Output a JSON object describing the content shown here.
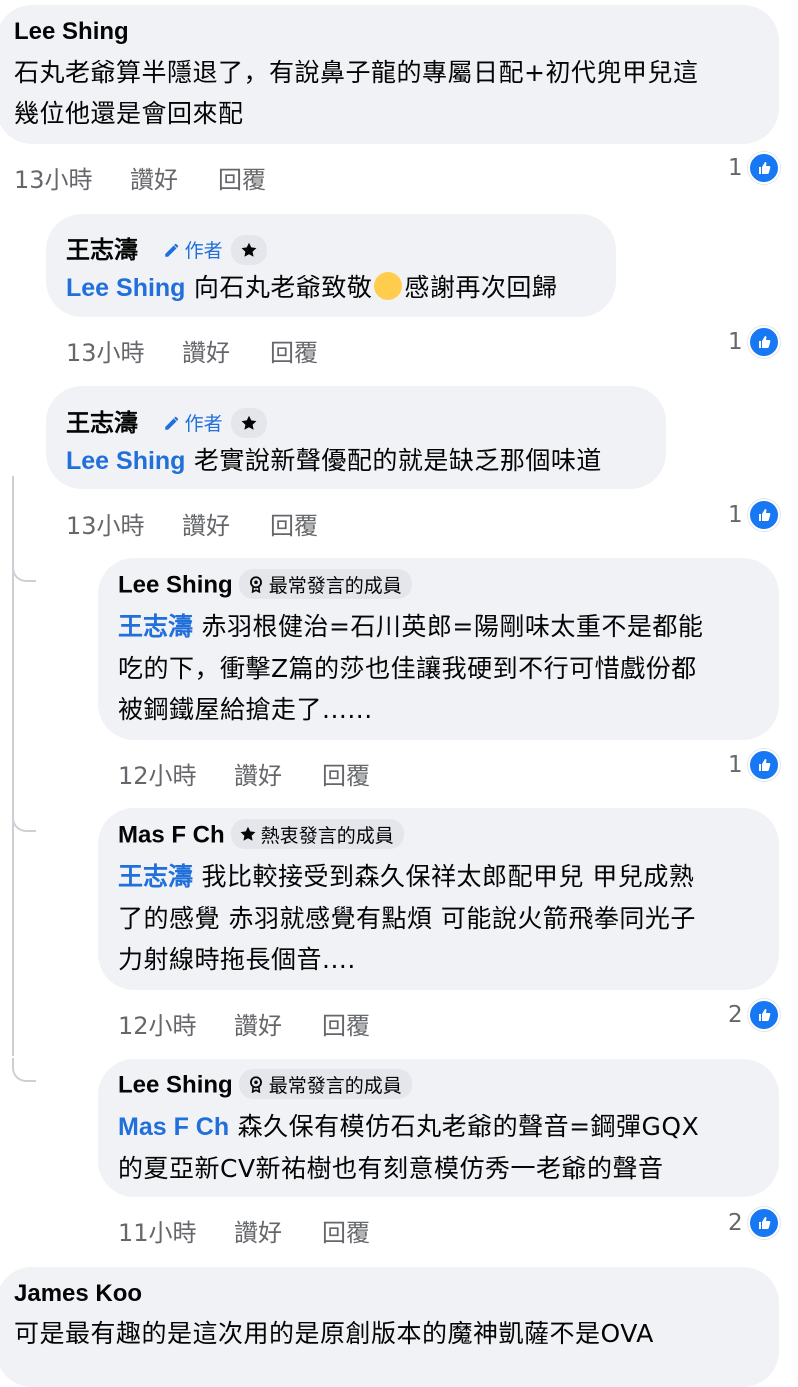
{
  "comments": [
    {
      "author": "Lee Shing",
      "lines": [
        "石丸老爺算半隱退了，有說鼻子龍的專屬日配+初代兜甲兒這",
        "幾位他還是會回來配"
      ],
      "time": "13小時",
      "like": "讚好",
      "reply": "回覆",
      "reactions": "1"
    },
    {
      "author": "王志濤",
      "author_badge": "作者",
      "mention": "Lee Shing",
      "text_a": " 向石丸老爺致敬",
      "text_b": "感謝再次回歸",
      "time": "13小時",
      "like": "讚好",
      "reply": "回覆",
      "reactions": "1"
    },
    {
      "author": "王志濤",
      "author_badge": "作者",
      "mention": "Lee Shing",
      "text": " 老實說新聲優配的就是缺乏那個味道",
      "time": "13小時",
      "like": "讚好",
      "reply": "回覆",
      "reactions": "1"
    },
    {
      "author": "Lee Shing",
      "member_badge": "最常發言的成員",
      "mention": "王志濤",
      "line1": " 赤羽根健治=石川英郎=陽剛味太重不是都能",
      "line2": "吃的下，衝擊Z篇的莎也佳讓我硬到不行可惜戲份都",
      "line3": "被鋼鐵屋給搶走了......",
      "time": "12小時",
      "like": "讚好",
      "reply": "回覆",
      "reactions": "1"
    },
    {
      "author": "Mas F Ch",
      "member_badge": "熱衷發言的成員",
      "mention": "王志濤",
      "line1": " 我比較接受到森久保祥太郎配甲兒 甲兒成熟",
      "line2": "了的感覺 赤羽就感覺有點煩 可能說火箭飛拳同光子",
      "line3": "力射線時拖長個音....",
      "time": "12小時",
      "like": "讚好",
      "reply": "回覆",
      "reactions": "2"
    },
    {
      "author": "Lee Shing",
      "member_badge": "最常發言的成員",
      "mention": "Mas F Ch",
      "line1": " 森久保有模仿石丸老爺的聲音=鋼彈GQX",
      "line2": "的夏亞新CV新祐樹也有刻意模仿秀一老爺的聲音",
      "time": "11小時",
      "like": "讚好",
      "reply": "回覆",
      "reactions": "2"
    },
    {
      "author": "James Koo",
      "text": "可是最有趣的是這次用的是原創版本的魔神凱薩不是OVA"
    }
  ],
  "colors": {
    "mention": "#216fdb",
    "like_blue": "#1877f2",
    "bubble": "#f0f2f5",
    "meta": "#65676b"
  },
  "icons": {
    "author": "pencil-icon",
    "star": "star-icon",
    "top_contributor": "badge-icon",
    "like": "thumbs-up-icon",
    "emoji": "saluting-face-emoji"
  }
}
